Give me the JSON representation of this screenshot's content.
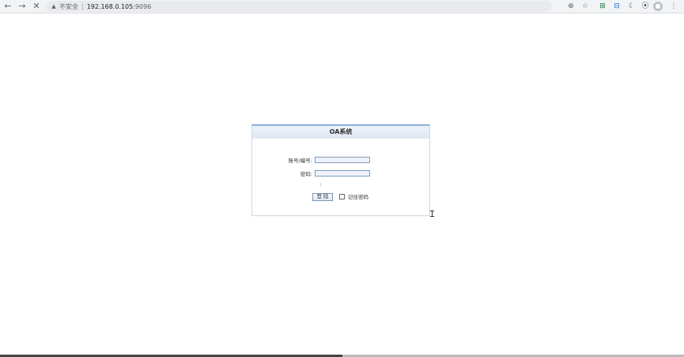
{
  "browser": {
    "back_icon": "←",
    "forward_icon": "→",
    "stop_icon": "✕",
    "security_label": "不安全",
    "separator": "|",
    "url_host": "192.168.0.105",
    "url_port": ":9096",
    "extensions": [
      "⊕",
      "☆",
      "⊞",
      "⊟",
      "☾",
      "⦿",
      "⋮"
    ]
  },
  "login": {
    "title": "OA系统",
    "account_label": "账号/编号:",
    "account_value": "",
    "password_label": "密码:",
    "password_value": "",
    "login_button": "登 陆",
    "remember_label": "记住密码",
    "remember_checked": false
  },
  "colors": {
    "panel_border_top": "#8aaedc",
    "field_border": "#7f9db9"
  }
}
